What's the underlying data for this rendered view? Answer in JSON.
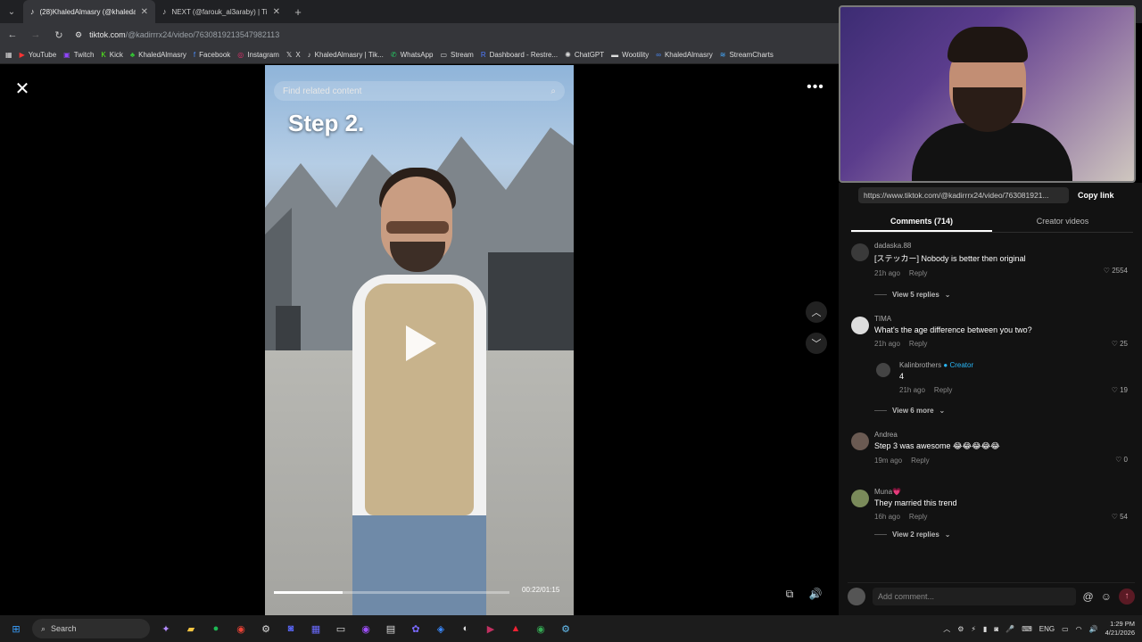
{
  "browser": {
    "tabs": [
      {
        "label": "(28)KhaledAlmasry (@khaledal",
        "active": true
      },
      {
        "label": "NEXT (@farouk_al3araby) | TikT",
        "active": false
      }
    ],
    "url_domain": "tiktok.com",
    "url_path": "/@kadirrrx24/video/7630819213547982113",
    "bookmarks": [
      {
        "label": "YouTube",
        "icon": "youtube-icon"
      },
      {
        "label": "Twitch",
        "icon": "twitch-icon"
      },
      {
        "label": "Kick",
        "icon": "kick-icon"
      },
      {
        "label": "KhaledAlmasry",
        "icon": "leaf-icon"
      },
      {
        "label": "Facebook",
        "icon": "facebook-icon"
      },
      {
        "label": "Instagram",
        "icon": "instagram-icon"
      },
      {
        "label": "X",
        "icon": "x-icon"
      },
      {
        "label": "KhaledAlmasry | Tik...",
        "icon": "tiktok-icon"
      },
      {
        "label": "WhatsApp",
        "icon": "whatsapp-icon"
      },
      {
        "label": "Stream",
        "icon": "folder-icon"
      },
      {
        "label": "Dashboard - Restre...",
        "icon": "restream-icon"
      },
      {
        "label": "ChatGPT",
        "icon": "chatgpt-icon"
      },
      {
        "label": "Wootility",
        "icon": "wooting-icon"
      },
      {
        "label": "KhaledAlmasry",
        "icon": "meta-icon"
      },
      {
        "label": "StreamCharts",
        "icon": "streamcharts-icon"
      }
    ]
  },
  "video": {
    "search_placeholder": "Find related content",
    "overlay_text": "Step 2.",
    "time": "00:22/01:15",
    "progress": 0.29
  },
  "panel": {
    "share_url": "https://www.tiktok.com/@kadirrrx24/video/763081921...",
    "copy_label": "Copy link",
    "tabs": [
      "Comments (714)",
      "Creator videos"
    ],
    "comments": [
      {
        "user": "dadaska.88",
        "text": "[ステッカー] Nobody is better then original",
        "time": "21h ago",
        "reply": "Reply",
        "likes": "2554",
        "view_more": "View 5 replies"
      },
      {
        "user": "TIMA",
        "text": "What's the age difference between you two?",
        "time": "21h ago",
        "reply": "Reply",
        "likes": "25"
      },
      {
        "user": "Kalinbrothers",
        "creator_tag": "Creator",
        "text": "4",
        "time": "21h ago",
        "reply": "Reply",
        "likes": "19",
        "view_more": "View 6 more",
        "nested": true
      },
      {
        "user": "Andrea",
        "text": "Step 3 was awesome 😂😂😂😂😂",
        "time": "19m ago",
        "reply": "Reply",
        "likes": "0"
      },
      {
        "user": "Muna💗",
        "text": "They married this trend",
        "time": "16h ago",
        "reply": "Reply",
        "likes": "54",
        "view_more": "View 2 replies"
      }
    ],
    "add_placeholder": "Add comment..."
  },
  "taskbar": {
    "search_label": "Search",
    "tray_lang": "ENG",
    "time": "1:29 PM",
    "date": "4/21/2026"
  }
}
